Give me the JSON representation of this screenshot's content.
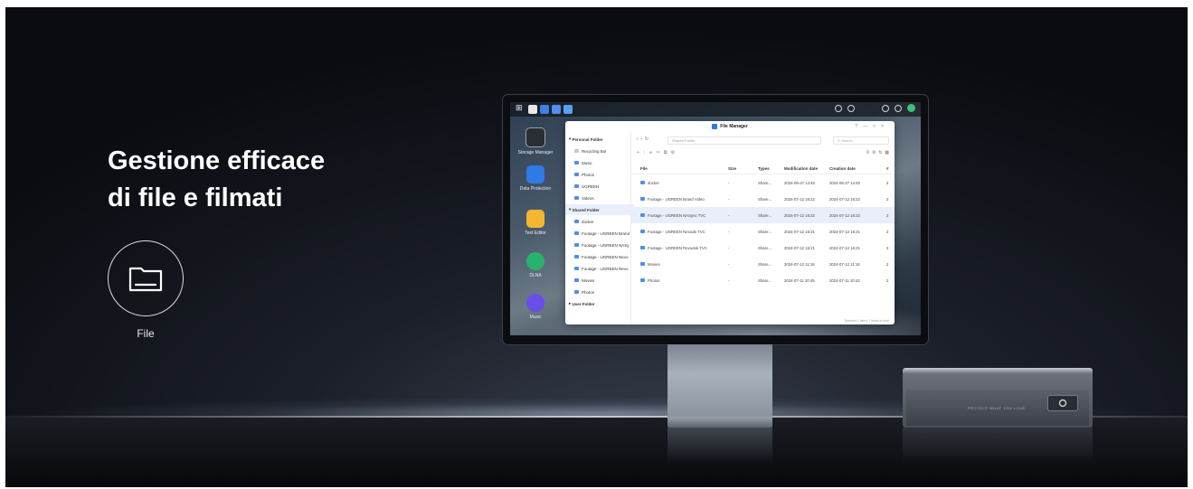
{
  "hero": {
    "headline_line1": "Gestione efficace",
    "headline_line2": "di file e filmati",
    "feature_label": "File"
  },
  "desktop": {
    "dock": [
      "Storage Manager",
      "Data Protection",
      "Text Editor",
      "DLNA",
      "Music"
    ]
  },
  "file_manager": {
    "title": "File Manager",
    "path": "Shared Folder",
    "search_placeholder": "Search",
    "sidebar": {
      "personal_header": "Personal Folder",
      "personal_items": [
        "Recycling Bin",
        "Music",
        "Photos",
        "UGREEN",
        "Videos"
      ],
      "shared_header": "Shared Folder",
      "shared_items": [
        "docker",
        "Footage - UGREEN Brand",
        "Footage - UGREEN NASy",
        "Footage - UGREEN Nexo",
        "Footage - UGREEN Revo",
        "Movies",
        "Photos"
      ],
      "user_header": "User Folder"
    },
    "columns": [
      "File",
      "Size",
      "Types",
      "Modification date",
      "Creation date",
      "#"
    ],
    "rows": [
      {
        "name": "docker",
        "size": "-",
        "type": "Share...",
        "modified": "2024-06-27 14:45",
        "created": "2024-06-27 14:45",
        "count": "2"
      },
      {
        "name": "Footage - UGREEN Brand Video",
        "size": "-",
        "type": "Share...",
        "modified": "2024-07-12 16:22",
        "created": "2024-07-12 16:22",
        "count": "2"
      },
      {
        "name": "Footage - UGREEN NASync TVC",
        "size": "-",
        "type": "Share...",
        "modified": "2024-07-12 16:22",
        "created": "2024-07-12 16:22",
        "count": "2"
      },
      {
        "name": "Footage - UGREEN Nexode TVC",
        "size": "-",
        "type": "Share...",
        "modified": "2024-07-12 16:21",
        "created": "2024-07-12 16:21",
        "count": "2"
      },
      {
        "name": "Footage - UGREEN Revodok TVC",
        "size": "-",
        "type": "Share...",
        "modified": "2024-07-12 16:21",
        "created": "2024-07-12 16:21",
        "count": "2"
      },
      {
        "name": "Movies",
        "size": "-",
        "type": "Share...",
        "modified": "2024-07-12 11:16",
        "created": "2024-07-12 11:16",
        "count": "2"
      },
      {
        "name": "Photos",
        "size": "-",
        "type": "Share...",
        "modified": "2024-07-11 10:45",
        "created": "2024-07-11 10:42",
        "count": "2"
      }
    ],
    "footer": "Selected 1 item | 7 items in total"
  },
  "nas_device": {
    "front_text": "PROTECT WHAT YOU LOVE"
  },
  "colors": {
    "accent": "#2f7ae5",
    "background": "#0f1217",
    "headline": "#ffffff"
  }
}
